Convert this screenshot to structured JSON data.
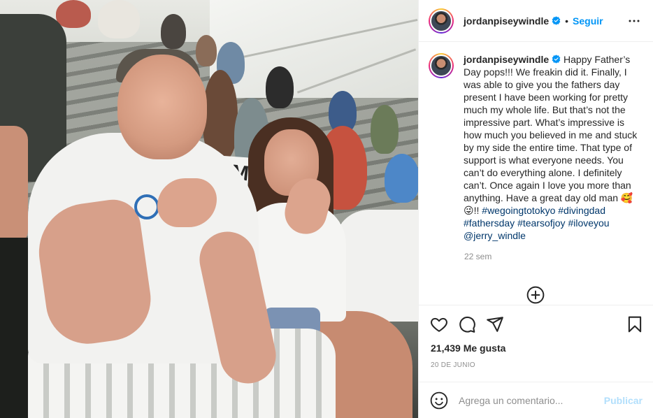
{
  "post": {
    "author": "jordanpiseywindle",
    "follow_label": "Seguir",
    "separator": "•",
    "caption_before": " Happy Father’s Day pops!!! We freakin did it. Finally, I was able to give you the fathers day present I have been working for pretty much my whole life. But that’s not the impressive part. What’s impressive is how much you believed in me and stuck by my side the entire time. That type of support is what everyone needs. You can’t do everything alone. I definitely can’t. Once again I love you more than anything. Have a great day old man ",
    "caption_emoji": "🥰😜",
    "caption_after": "!! ",
    "hashtags": [
      "#wegoingtotokyo",
      "#divingdad",
      "#fathersday",
      "#tearsofjoy",
      "#iloveyou",
      "@jerry_windle"
    ],
    "age": "22 sem",
    "likes": "21,439 Me gusta",
    "date": "20 DE JUNIO"
  },
  "photo": {
    "sign_text": "TEAM"
  },
  "comment_box": {
    "placeholder": "Agrega un comentario...",
    "publish_label": "Publicar"
  },
  "colors": {
    "accent": "#0095f6",
    "link": "#00376b",
    "muted": "#8e8e8e",
    "publish_disabled": "#b2dffc"
  },
  "icons": {
    "header": [
      "verified-badge-icon",
      "more-options-icon"
    ],
    "actions": [
      "heart-icon",
      "comment-icon",
      "share-icon",
      "save-icon"
    ],
    "comments": [
      "load-more-plus-icon"
    ],
    "input": [
      "emoji-icon"
    ]
  }
}
